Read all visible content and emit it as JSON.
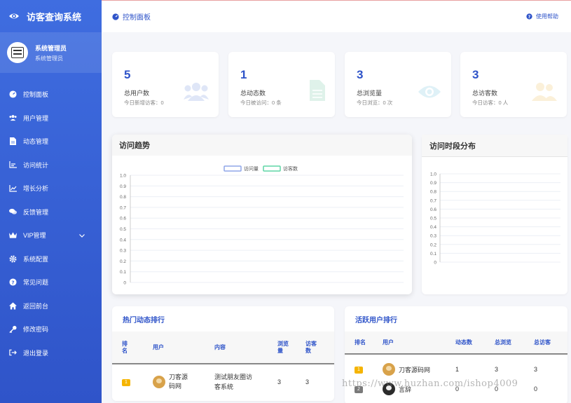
{
  "brand": {
    "title": "访客查询系统"
  },
  "user": {
    "name": "系统管理员",
    "role": "系统管理员"
  },
  "sidebar": {
    "items": [
      {
        "label": "控制面板",
        "icon": "dashboard-icon"
      },
      {
        "label": "用户管理",
        "icon": "users-icon"
      },
      {
        "label": "动态管理",
        "icon": "file-icon"
      },
      {
        "label": "访问统计",
        "icon": "bar-chart-icon"
      },
      {
        "label": "增长分析",
        "icon": "line-chart-icon"
      },
      {
        "label": "反馈管理",
        "icon": "comments-icon"
      },
      {
        "label": "VIP管理",
        "icon": "crown-icon"
      },
      {
        "label": "系统配置",
        "icon": "gear-icon"
      },
      {
        "label": "常见问题",
        "icon": "question-icon"
      },
      {
        "label": "返回前台",
        "icon": "home-icon"
      },
      {
        "label": "修改密码",
        "icon": "key-icon"
      },
      {
        "label": "退出登录",
        "icon": "logout-icon"
      }
    ]
  },
  "topbar": {
    "breadcrumb": "控制面板",
    "help": "使用帮助"
  },
  "stats": [
    {
      "value": "5",
      "label": "总用户数",
      "sub": "今日新增访客：0",
      "icon": "users-icon",
      "color": "#dfe6f7"
    },
    {
      "value": "1",
      "label": "总动态数",
      "sub": "今日被访问：0 条",
      "icon": "file-icon",
      "color": "#dff2ea"
    },
    {
      "value": "3",
      "label": "总浏览量",
      "sub": "今日浏览：0 次",
      "icon": "eye-icon",
      "color": "#dff1f7"
    },
    {
      "value": "3",
      "label": "总访客数",
      "sub": "今日访客：0 人",
      "icon": "users-icon",
      "color": "#fbf0d9"
    }
  ],
  "trend": {
    "title": "访问趋势",
    "chart_data": {
      "type": "line",
      "categories": [],
      "series": [
        {
          "name": "访问量",
          "values": [],
          "color": "#8fa6e8"
        },
        {
          "name": "访客数",
          "values": [],
          "color": "#5fd6a6"
        }
      ],
      "ylim": [
        0,
        1
      ],
      "yticks": [
        "0",
        "0.1",
        "0.2",
        "0.3",
        "0.4",
        "0.5",
        "0.6",
        "0.7",
        "0.8",
        "0.9",
        "1.0"
      ],
      "legend": "top-center",
      "grid": true
    }
  },
  "distribution": {
    "title": "访问时段分布",
    "chart_data": {
      "type": "bar",
      "categories": [],
      "values": [],
      "ylim": [
        0,
        1
      ],
      "yticks": [
        "0",
        "0.1",
        "0.2",
        "0.3",
        "0.4",
        "0.5",
        "0.6",
        "0.7",
        "0.8",
        "0.9",
        "1.0"
      ],
      "grid": true
    }
  },
  "hot_posts": {
    "title": "热门动态排行",
    "headers": [
      "排名",
      "用户",
      "内容",
      "浏览量",
      "访客数"
    ],
    "rows": [
      {
        "rank": "1",
        "rank_color": "#f5b400",
        "user": "刀客源码网",
        "content": "测试朋友圈访客系统",
        "views": "3",
        "visitors": "3"
      }
    ]
  },
  "active_users": {
    "title": "活跃用户排行",
    "headers": [
      "排名",
      "用户",
      "动态数",
      "总浏览",
      "总访客"
    ],
    "rows": [
      {
        "rank": "1",
        "rank_color": "#f5b400",
        "user": "刀客源码网",
        "posts": "1",
        "views": "3",
        "visitors": "3",
        "avatar": "light"
      },
      {
        "rank": "2",
        "rank_color": "#7a7a7a",
        "user": "言辞",
        "posts": "0",
        "views": "0",
        "visitors": "0",
        "avatar": "dark"
      }
    ]
  },
  "watermark": "https://www.huzhan.com/ishop4009"
}
